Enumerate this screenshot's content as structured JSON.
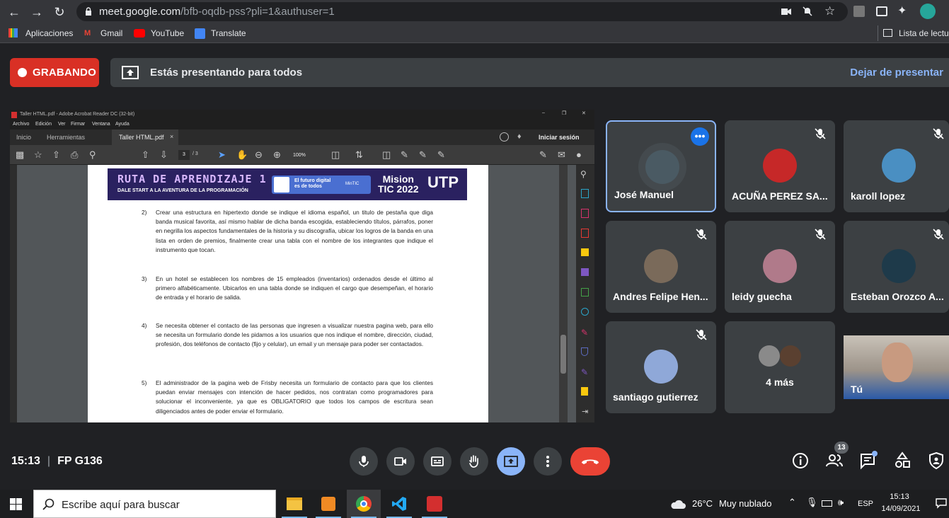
{
  "browser": {
    "url_host": "meet.google.com",
    "url_path": "/bfb-oqdb-pss?pli=1&authuser=1",
    "bookmarks": [
      "Aplicaciones",
      "Gmail",
      "YouTube",
      "Translate"
    ],
    "reading_list": "Lista de lectu"
  },
  "meet": {
    "recording_label": "GRABANDO",
    "presenting_label": "Estás presentando para todos",
    "stop_presenting": "Dejar de presentar",
    "time": "15:13",
    "meeting_code": "FP G136",
    "participant_count": "13"
  },
  "acrobat": {
    "window_title": "Taller HTML.pdf - Adobe Acrobat Reader DC (32-bit)",
    "menu": [
      "Archivo",
      "Edición",
      "Ver",
      "Firmar",
      "Ventana",
      "Ayuda"
    ],
    "tabs": [
      "Inicio",
      "Herramientas",
      "Taller HTML.pdf"
    ],
    "sign_in": "Iniciar sesión",
    "page_current": "3",
    "page_total": "/ 3",
    "zoom": "100%",
    "banner": {
      "line1": "RUTA DE APRENDIZAJE 1",
      "line2": "DALE START A LA AVENTURA DE LA PROGRAMACIÓN",
      "future": "El futuro digital es de todos",
      "mintic": "MinTIC",
      "mision1": "Mision",
      "mision2": "TIC 2022",
      "utp": "UTP"
    },
    "questions": [
      {
        "n": "2)",
        "text": "Crear una estructura en hipertexto donde se indique el idioma español, un titulo de pestaña que diga banda musical favorita, así mismo hablar de dicha banda escogida, estableciendo títulos, párrafos, poner en negrilla los aspectos fundamentales de la historia y su discografía, ubicar los logros de la banda en una lista en orden de premios, finalmente crear una tabla con el nombre de los integrantes que indique el instrumento que tocan."
      },
      {
        "n": "3)",
        "text": "En un hotel se establecen los nombres de 15 empleados (inventarios) ordenados desde el último al primero alfabéticamente. Ubicarlos en una tabla donde se indiquen el cargo que desempeñan, el horario de entrada y el horario de salida."
      },
      {
        "n": "4)",
        "text": "Se necesita obtener el contacto de las personas que ingresen a visualizar nuestra pagina web, para ello se necesita un formulario donde les pidamos a los usuarios que nos indique el nombre, dirección, ciudad, profesión, dos teléfonos de contacto (fijo y celular), un email y un mensaje para poder ser contactados."
      },
      {
        "n": "5)",
        "text": "El administrador de la pagina web de Frisby necesita un formulario de contacto para que los clientes puedan enviar mensajes con intención de hacer pedidos, nos contratan como programadores para solucionar el inconveniente, ya que es OBLIGATORIO que todos los campos de escritura sean diligenciados antes de poder enviar el formulario."
      }
    ]
  },
  "participants": [
    {
      "name": "José Manuel",
      "color": "#4a5a63"
    },
    {
      "name": "ACUÑA PEREZ SA...",
      "color": "#c62828"
    },
    {
      "name": "karoll lopez",
      "color": "#4a8fc2"
    },
    {
      "name": "Andres Felipe Hen...",
      "color": "#7a6a5a"
    },
    {
      "name": "leidy guecha",
      "color": "#b07a8a"
    },
    {
      "name": "Esteban Orozco A...",
      "color": "#1e3a4a"
    },
    {
      "name": "santiago gutierrez",
      "color": "#8fa8d8"
    },
    {
      "name": "4 más",
      "color": "#5f6368"
    },
    {
      "name": "Tú",
      "color": "#6a7a8a"
    }
  ],
  "taskbar": {
    "search_placeholder": "Escribe aquí para buscar",
    "weather_temp": "26°C",
    "weather_text": "Muy nublado",
    "lang": "ESP",
    "time": "15:13",
    "date": "14/09/2021"
  }
}
